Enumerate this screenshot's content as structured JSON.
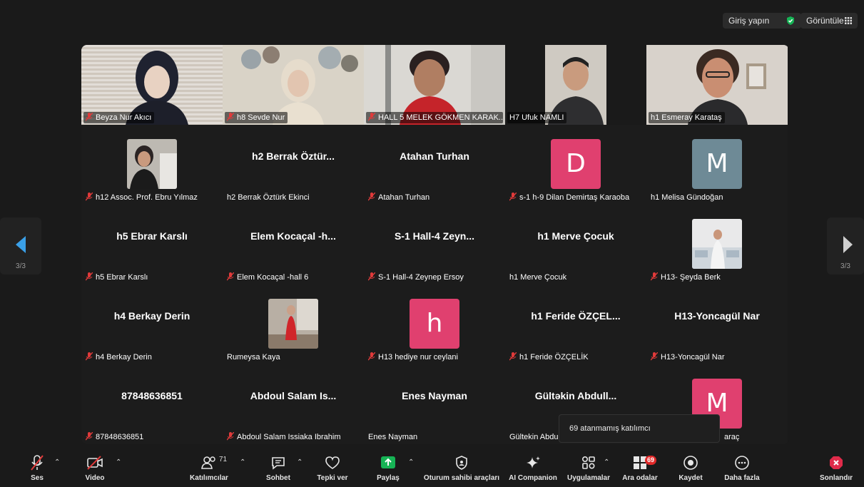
{
  "topbar": {
    "login_label": "Giriş yapın",
    "view_label": "Görüntüle"
  },
  "pager": {
    "left": "3/3",
    "right": "3/3"
  },
  "tiles": [
    {
      "name": "Beyza Nur Akıcı",
      "muted": true
    },
    {
      "name": "h8 Sevde Nur",
      "muted": true
    },
    {
      "name": "HALL 5 MELEK GÖKMEN KARAK...",
      "muted": true
    },
    {
      "name": "H7 Ufuk NAMLI",
      "muted": false
    },
    {
      "name": "h1 Esmeray Karataş",
      "muted": false
    },
    {
      "name": "h12 Assoc. Prof. Ebru Yılmaz",
      "muted": true
    },
    {
      "name": "h2 Berrak Öztürk Ekinci",
      "big": "h2  Berrak  Öztür...",
      "muted": false
    },
    {
      "name": "Atahan Turhan",
      "big": "Atahan Turhan",
      "muted": true
    },
    {
      "name": "s-1 h-9 Dilan Demirtaş Karaoba",
      "initial": "D",
      "muted": true
    },
    {
      "name": "h1 Melisa Gündoğan",
      "initial": "M",
      "muted": false
    },
    {
      "name": "h5 Ebrar Karslı",
      "big": "h5 Ebrar Karslı",
      "muted": true
    },
    {
      "name": "Elem Kocaçal -hall 6",
      "big": "Elem  Kocaçal  -h...",
      "muted": true
    },
    {
      "name": "S-1 Hall-4 Zeynep Ersoy",
      "big": "S-1  Hall-4  Zeyn...",
      "muted": true
    },
    {
      "name": "h1 Merve Çocuk",
      "big": "h1 Merve Çocuk",
      "muted": false
    },
    {
      "name": "H13- Şeyda Berk",
      "muted": true
    },
    {
      "name": "h4 Berkay Derin",
      "big": "h4 Berkay Derin",
      "muted": true
    },
    {
      "name": "Rumeysa Kaya",
      "muted": false
    },
    {
      "name": "H13 hediye nur ceylani",
      "initial": "h",
      "muted": true
    },
    {
      "name": "h1 Feride ÖZÇELİK",
      "big": "h1  Feride  ÖZÇEL...",
      "muted": true
    },
    {
      "name": "H13-Yoncagül Nar",
      "big": "H13-Yoncagül Nar",
      "muted": true
    },
    {
      "name": "87848636851",
      "big": "87848636851",
      "muted": true
    },
    {
      "name": "Abdoul Salam Issiaka Ibrahim",
      "big": "Abdoul  Salam  Is...",
      "muted": true
    },
    {
      "name": "Enes Nayman",
      "big": "Enes Nayman",
      "muted": false
    },
    {
      "name": "Gültekin Abdu",
      "big": "Gültəkin  Abdull...",
      "muted": false
    },
    {
      "name": "araç",
      "initial": "M",
      "muted": false
    }
  ],
  "tooltip": "69 atanmamış katılımcı",
  "toolbar": {
    "audio": "Ses",
    "video": "Video",
    "participants": "Katılımcılar",
    "participants_count": "71",
    "chat": "Sohbet",
    "react": "Tepki ver",
    "share": "Paylaş",
    "host_tools": "Oturum sahibi araçları",
    "ai": "AI Companion",
    "apps": "Uygulamalar",
    "breakout": "Ara odalar",
    "breakout_badge": "69",
    "record": "Kaydet",
    "more": "Daha fazla",
    "end": "Sonlandır"
  },
  "colors": {
    "avatar_pink": "#e0406f",
    "avatar_gray": "#6e8a96",
    "accent_green": "#16b355",
    "nav_blue": "#3aa0e8",
    "mute_red": "#e03a3a"
  }
}
